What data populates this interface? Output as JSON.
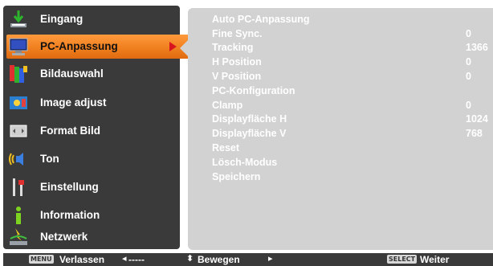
{
  "menu": {
    "items": [
      {
        "label": "Eingang",
        "icon": "input-icon"
      },
      {
        "label": "PC-Anpassung",
        "icon": "pc-adjust-icon",
        "selected": true
      },
      {
        "label": "Bildauswahl",
        "icon": "image-select-icon"
      },
      {
        "label": "Image adjust",
        "icon": "image-adjust-icon"
      },
      {
        "label": "Format Bild",
        "icon": "screen-format-icon"
      },
      {
        "label": "Ton",
        "icon": "sound-icon"
      },
      {
        "label": "Einstellung",
        "icon": "setting-icon"
      },
      {
        "label": "Information",
        "icon": "information-icon"
      },
      {
        "label": "Netzwerk",
        "icon": "network-icon"
      }
    ]
  },
  "submenu": {
    "items": [
      {
        "label": "Auto PC-Anpassung",
        "value": ""
      },
      {
        "label": "Fine Sync.",
        "value": "0"
      },
      {
        "label": "Tracking",
        "value": "1366"
      },
      {
        "label": "H Position",
        "value": "0"
      },
      {
        "label": "V Position",
        "value": "0"
      },
      {
        "label": "PC-Konfiguration",
        "value": ""
      },
      {
        "label": "Clamp",
        "value": "0"
      },
      {
        "label": "Displayfläche H",
        "value": "1024"
      },
      {
        "label": "Displayfläche V",
        "value": "768"
      },
      {
        "label": "Reset",
        "value": ""
      },
      {
        "label": "Lösch-Modus",
        "value": ""
      },
      {
        "label": "Speichern",
        "value": ""
      }
    ]
  },
  "footer": {
    "menu_key": "MENU",
    "exit_label": "Verlassen",
    "back_hint": "-----",
    "move_label": "Bewegen",
    "select_key": "SELECT",
    "next_label": "Weiter"
  },
  "colors": {
    "menu_bg": "#3a3a3a",
    "selected_bg": "#f08020",
    "panel_bg": "#d2d2d2",
    "arrow": "#d8141e"
  }
}
